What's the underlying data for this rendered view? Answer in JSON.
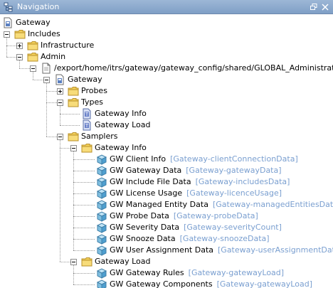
{
  "window": {
    "title": "Navigation",
    "icon": "navigation-tree-icon",
    "buttons": [
      "restore-icon",
      "close-icon"
    ]
  },
  "tree": {
    "gateway_root": "Gateway",
    "includes": "Includes",
    "infrastructure": "Infrastructure",
    "admin": "Admin",
    "xml_file": "/export/home/itrs/gateway/gateway_config/shared/GLOBAL_Administration.xml",
    "gateway": "Gateway",
    "probes": "Probes",
    "types": "Types",
    "type_items": [
      "Gateway Info",
      "Gateway Load"
    ],
    "samplers": "Samplers",
    "gateway_info": "Gateway Info",
    "info_samplers": [
      {
        "name": "GW Client Info",
        "path": "[Gateway-clientConnectionData]"
      },
      {
        "name": "GW Gateway Data",
        "path": "[Gateway-gatewayData]"
      },
      {
        "name": "GW Include File Data",
        "path": "[Gateway-includesData]"
      },
      {
        "name": "GW License Usage",
        "path": "[Gateway-licenceUsage]"
      },
      {
        "name": "GW Managed Entity Data",
        "path": "[Gateway-managedEntitiesData]"
      },
      {
        "name": "GW Probe Data",
        "path": "[Gateway-probeData]"
      },
      {
        "name": "GW Severity Data",
        "path": "[Gateway-severityCount]"
      },
      {
        "name": "GW Snooze Data",
        "path": "[Gateway-snoozeData]"
      },
      {
        "name": "GW User Assignment Data",
        "path": "[Gateway-userAssignmentData]"
      }
    ],
    "gateway_load": "Gateway Load",
    "load_samplers": [
      {
        "name": "GW Gateway Rules",
        "path": "[Gateway-gatewayLoad]"
      },
      {
        "name": "GW Gateway Components",
        "path": "[Gateway-gatewayLoad]"
      }
    ]
  },
  "colors": {
    "titlebar": "#8aa8cd",
    "path_text": "#7a9fd0",
    "folder": "#f2cf5a"
  }
}
